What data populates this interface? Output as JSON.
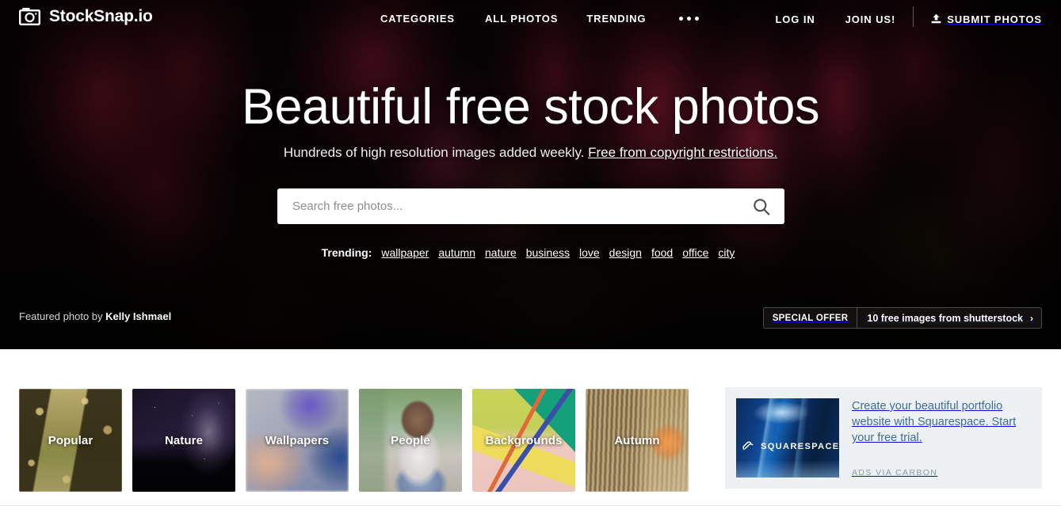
{
  "brand": {
    "name": "StockSnap.io",
    "logo_icon": "camera-icon"
  },
  "nav": {
    "center_links": [
      {
        "label": "CATEGORIES"
      },
      {
        "label": "ALL PHOTOS"
      },
      {
        "label": "TRENDING"
      }
    ],
    "more_icon": "ellipsis-icon",
    "right_links": [
      {
        "label": "LOG IN"
      },
      {
        "label": "JOIN US!"
      }
    ],
    "submit": {
      "label": "SUBMIT PHOTOS",
      "icon": "upload-icon"
    }
  },
  "hero": {
    "title": "Beautiful free stock photos",
    "subtitle_plain": "Hundreds of high resolution images added weekly.",
    "subtitle_link": "Free from copyright restrictions.",
    "credit_prefix": "Featured photo by",
    "credit_author": "Kelly Ishmael"
  },
  "search": {
    "placeholder": "Search free photos...",
    "value": "",
    "icon": "search-icon"
  },
  "trending": {
    "label": "Trending:",
    "tags": [
      "wallpaper",
      "autumn",
      "nature",
      "business",
      "love",
      "design",
      "food",
      "office",
      "city"
    ]
  },
  "offer": {
    "tag": "SPECIAL OFFER",
    "text": "10 free images from shutterstock",
    "arrow": "›"
  },
  "categories": [
    {
      "label": "Popular",
      "img": "img-popular"
    },
    {
      "label": "Nature",
      "img": "img-nature"
    },
    {
      "label": "Wallpapers",
      "img": "img-wallpapers"
    },
    {
      "label": "People",
      "img": "img-people"
    },
    {
      "label": "Backgrounds",
      "img": "img-backgrounds"
    },
    {
      "label": "Autumn",
      "img": "img-autumn"
    }
  ],
  "ad": {
    "brand": "SQUARESPACE",
    "brand_icon": "squarespace-logo-icon",
    "text": "Create your beautiful portfolio website with Squarespace. Start your free trial.",
    "credit": "ADS VIA CARBON"
  },
  "colors": {
    "hero_dark": "#0e0508",
    "hero_accent_red": "#b0203a",
    "ad_background": "#eef1f4",
    "ad_text": "#3d6d96",
    "page_background": "#ffffff"
  }
}
